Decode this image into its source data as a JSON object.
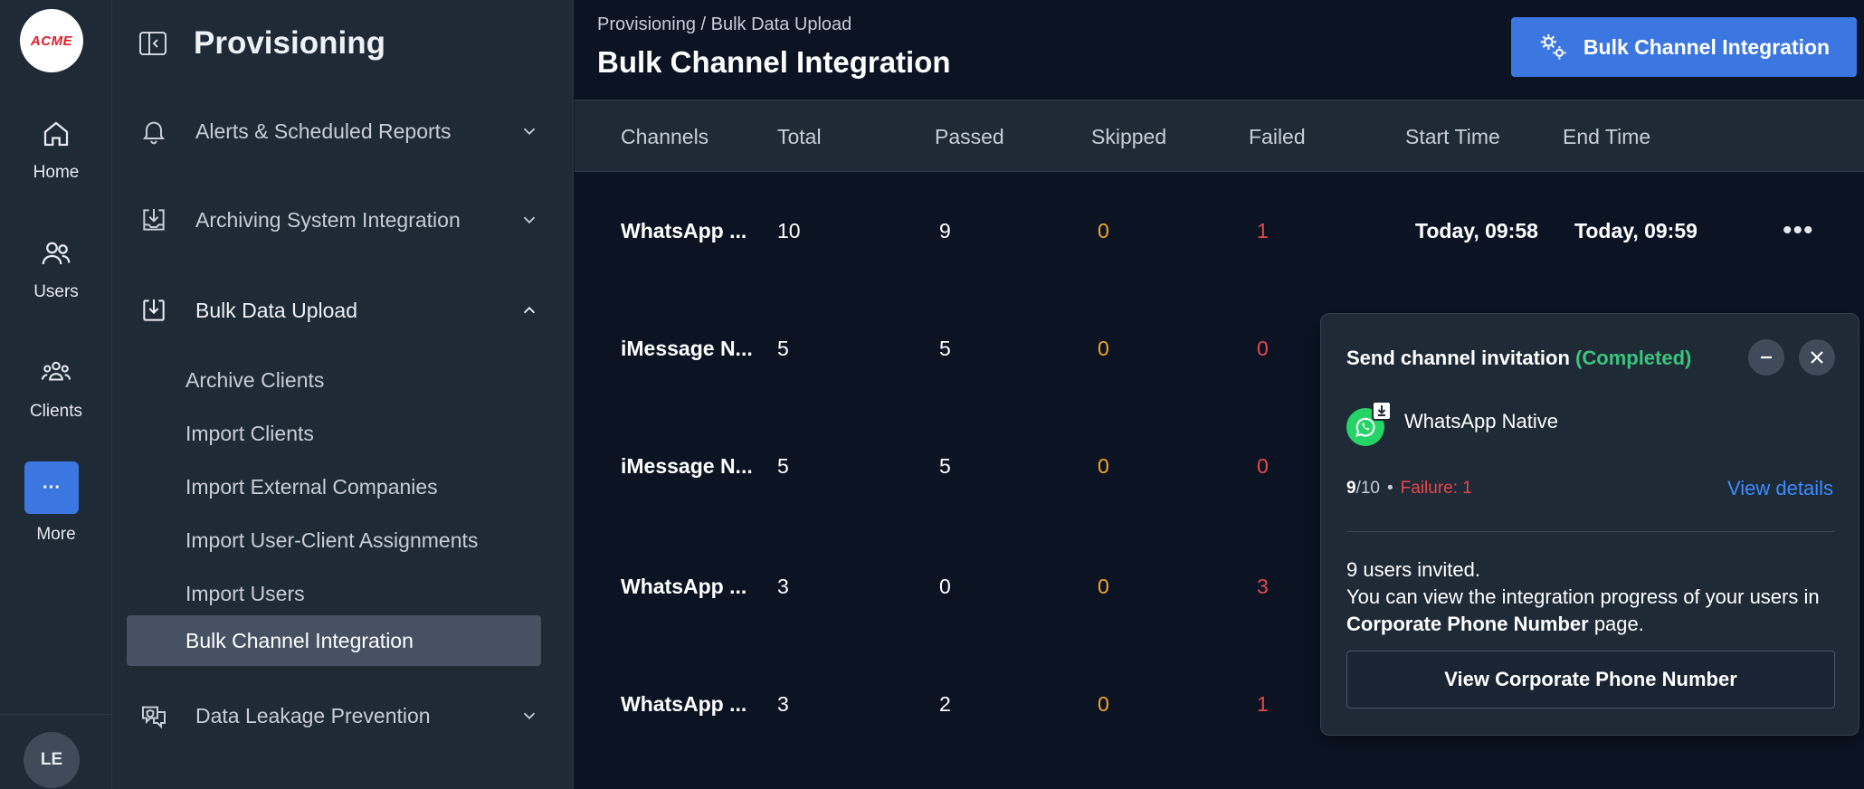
{
  "rail": {
    "logo_text": "ACME",
    "items": [
      {
        "label": "Home",
        "icon": "home-icon"
      },
      {
        "label": "Users",
        "icon": "users-icon"
      },
      {
        "label": "Clients",
        "icon": "clients-icon"
      },
      {
        "label": "More",
        "icon": "more-icon"
      }
    ],
    "more_glyph": "···",
    "avatar_initials": "LE"
  },
  "sidebar": {
    "title": "Provisioning",
    "menu": [
      {
        "label": "Alerts & Scheduled Reports",
        "icon": "bell-icon",
        "expanded": false
      },
      {
        "label": "Archiving System Integration",
        "icon": "archive-icon",
        "expanded": false
      },
      {
        "label": "Bulk Data Upload",
        "icon": "upload-icon",
        "expanded": true
      },
      {
        "label": "Data Leakage Prevention",
        "icon": "shield-chat-icon",
        "expanded": false
      }
    ],
    "submenu": [
      {
        "label": "Archive Clients"
      },
      {
        "label": "Import Clients"
      },
      {
        "label": "Import External Companies"
      },
      {
        "label": "Import User-Client Assignments"
      },
      {
        "label": "Import Users"
      },
      {
        "label": "Bulk Channel Integration",
        "active": true
      }
    ]
  },
  "main": {
    "breadcrumb": "Provisioning / Bulk Data Upload",
    "title": "Bulk Channel Integration",
    "primary_button": "Bulk Channel Integration",
    "table": {
      "columns": [
        "Channels",
        "Total",
        "Passed",
        "Skipped",
        "Failed",
        "Start Time",
        "End Time"
      ],
      "rows": [
        {
          "channel": "WhatsApp ...",
          "total": "10",
          "passed": "9",
          "skipped": "0",
          "failed": "1",
          "start": "Today, 09:58",
          "end": "Today, 09:59",
          "menu": "•••"
        },
        {
          "channel": "iMessage N...",
          "total": "5",
          "passed": "5",
          "skipped": "0",
          "failed": "0"
        },
        {
          "channel": "iMessage N...",
          "total": "5",
          "passed": "5",
          "skipped": "0",
          "failed": "0"
        },
        {
          "channel": "WhatsApp ...",
          "total": "3",
          "passed": "0",
          "skipped": "0",
          "failed": "3"
        },
        {
          "channel": "WhatsApp ...",
          "total": "3",
          "passed": "2",
          "skipped": "0",
          "failed": "1"
        }
      ]
    }
  },
  "popup": {
    "title": "Send channel invitation",
    "status": "(Completed)",
    "channel_name": "WhatsApp Native",
    "progress_done": "9",
    "progress_total": "/10",
    "progress_dot": "•",
    "failure": "Failure: 1",
    "view_details": "View details",
    "message_line1": "9 users invited.",
    "message_line2_a": "You can view the integration progress of your users in ",
    "message_line2_strong": "Corporate Phone Number",
    "message_line2_b": " page.",
    "button": "View Corporate Phone Number"
  },
  "colors": {
    "accent": "#3b76e1",
    "success": "#3ac47d",
    "warning": "#f5a623",
    "danger": "#e5484d",
    "link": "#3b8bff"
  }
}
